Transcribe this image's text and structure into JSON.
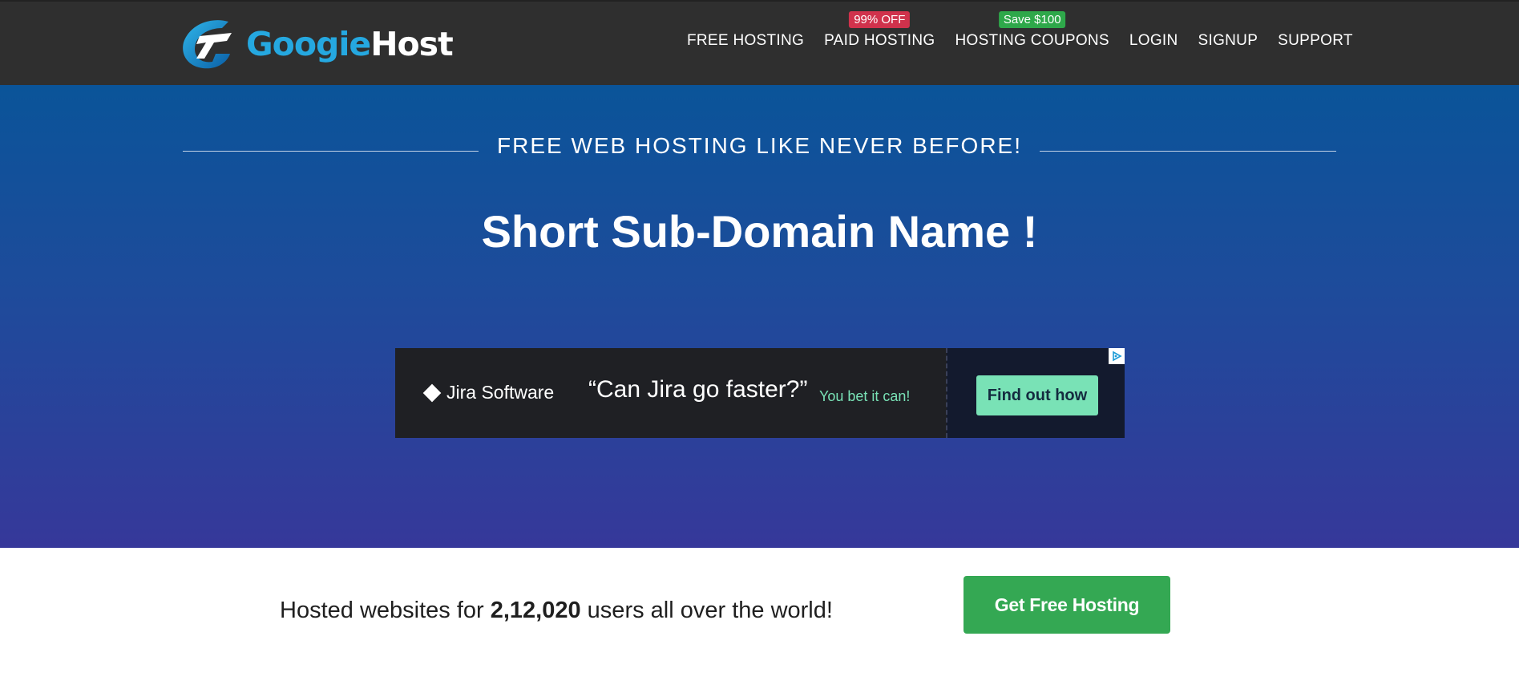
{
  "brand": {
    "part1": "Googie",
    "part2": "Host",
    "accent": "#25a8e0"
  },
  "nav": {
    "items": [
      {
        "label": "FREE HOSTING",
        "badge": ""
      },
      {
        "label": "PAID HOSTING",
        "badge": "99% OFF",
        "badge_color": "#d0324c"
      },
      {
        "label": "HOSTING COUPONS",
        "badge": "Save $100",
        "badge_color": "#2ea84a"
      },
      {
        "label": "LOGIN",
        "badge": ""
      },
      {
        "label": "SIGNUP",
        "badge": ""
      },
      {
        "label": "SUPPORT",
        "badge": ""
      }
    ]
  },
  "hero": {
    "tagline": "FREE WEB HOSTING LIKE NEVER BEFORE!",
    "headline": "Short Sub-Domain Name !"
  },
  "ad": {
    "brand": "Jira Software",
    "quote": "“Can Jira go faster?”",
    "subtext": "You bet it can!",
    "button": "Find out how",
    "icon": "adchoices-icon"
  },
  "stats": {
    "prefix": "Hosted websites for ",
    "count": "2,12,020",
    "suffix": " users all over the world!"
  },
  "cta": {
    "label": "Get Free Hosting",
    "color": "#34a853"
  }
}
